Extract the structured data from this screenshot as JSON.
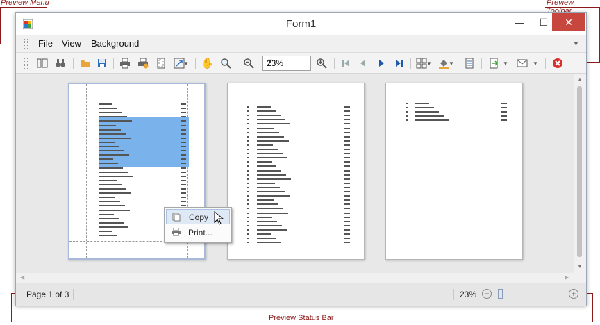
{
  "annotations": {
    "menu": "Preview Menu",
    "toolbar": "Preview Toolbar",
    "statusbar": "Preview Status Bar"
  },
  "window": {
    "title": "Form1",
    "minimize": "—",
    "maximize": "☐",
    "close": "✕"
  },
  "menu": {
    "items": [
      "File",
      "View",
      "Background"
    ]
  },
  "toolbar": {
    "zoom_value": "23%",
    "icons": [
      "document-map-icon",
      "search-binoculars-icon",
      "open-folder-icon",
      "save-icon",
      "print-icon",
      "quick-print-icon",
      "page-setup-icon",
      "scale-icon",
      "hand-tool-icon",
      "magnifier-icon",
      "zoom-out-icon",
      "zoom-in-icon",
      "first-page-icon",
      "previous-page-icon",
      "next-page-icon",
      "last-page-icon",
      "multiple-pages-icon",
      "page-color-icon",
      "watermark-icon",
      "export-icon",
      "send-email-icon",
      "exit-icon"
    ]
  },
  "context_menu": {
    "items": [
      "Copy",
      "Print..."
    ]
  },
  "status": {
    "page_info": "Page 1 of 3",
    "zoom_percent": "23%"
  },
  "colors": {
    "accent": "#1e5aa8",
    "close_button": "#c7463e",
    "selection": "#7ab2eb",
    "callout": "#8b1a1a"
  }
}
